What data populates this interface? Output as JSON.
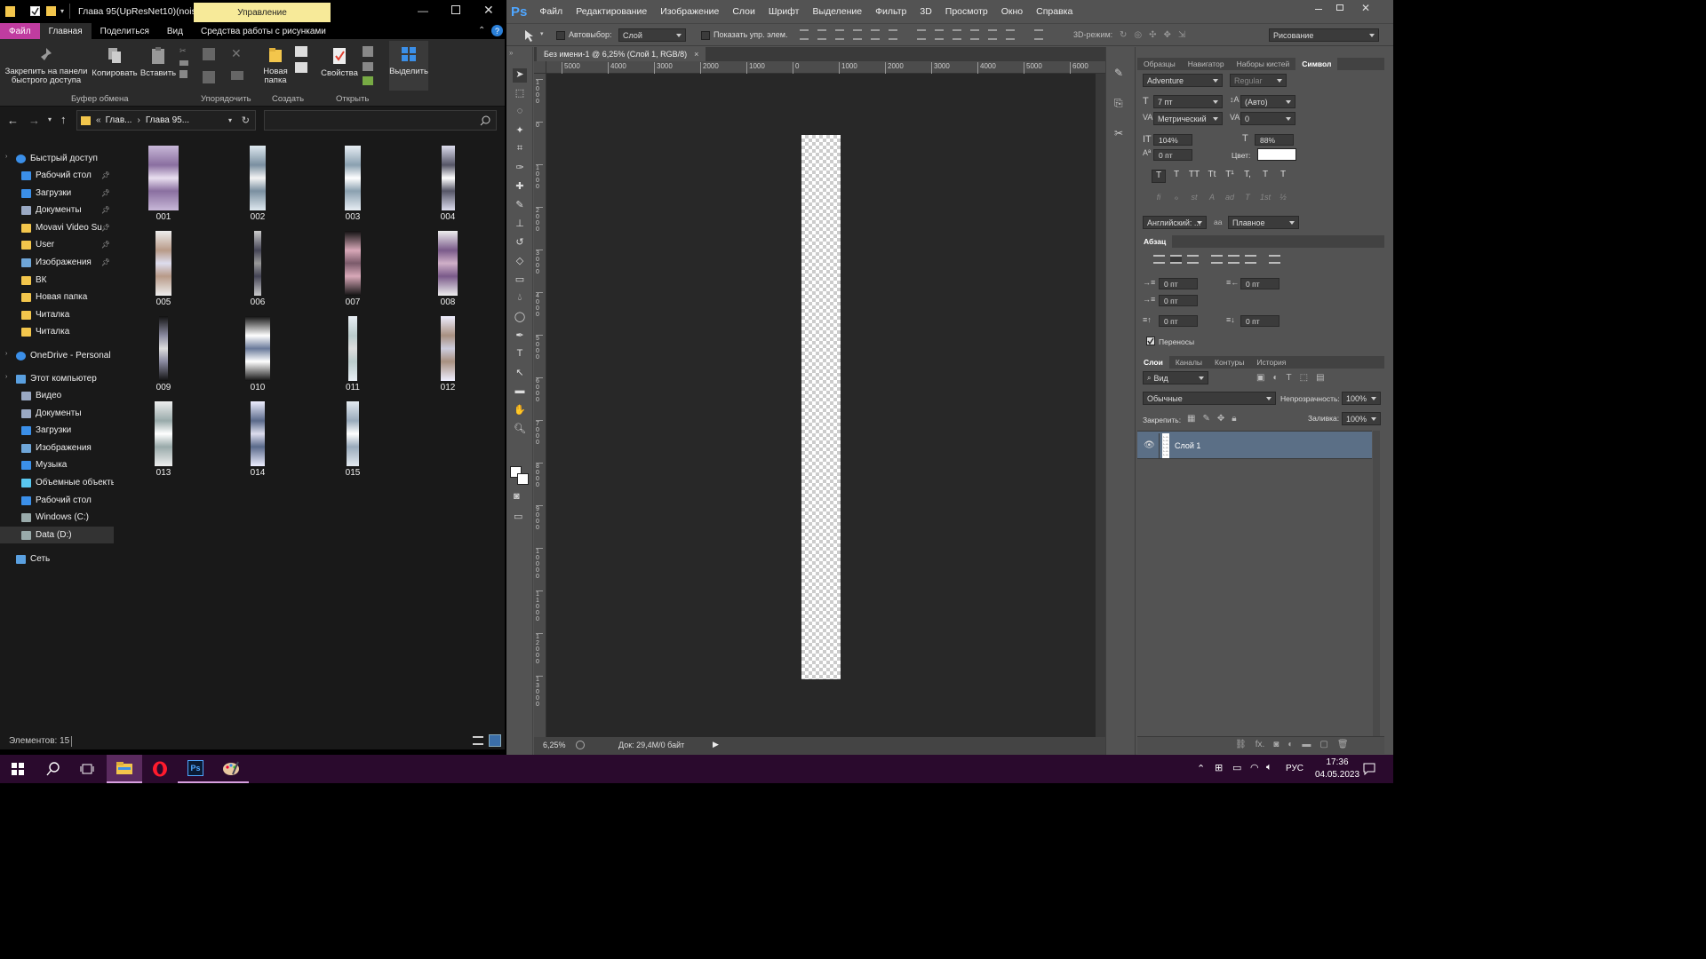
{
  "explorer": {
    "title": "Глава 95(UpResNet10)(nois...",
    "manage_tab": "Управление",
    "tabs": [
      "Файл",
      "Главная",
      "Поделиться",
      "Вид",
      "Средства работы с рисунками"
    ],
    "ribbon": {
      "pin_label": "Закрепить на панели быстрого доступа",
      "copy": "Копировать",
      "paste": "Вставить",
      "new_folder": "Новая папка",
      "properties": "Свойства",
      "select": "Выделить",
      "groups": [
        "Буфер обмена",
        "Упорядочить",
        "Создать",
        "Открыть"
      ]
    },
    "path_prefix": "«",
    "path": [
      "Глав...",
      "Глава 95..."
    ],
    "sidebar": [
      {
        "label": "Быстрый доступ",
        "icon": "star-icon",
        "color": "#3b8fe8"
      },
      {
        "label": "Рабочий стол",
        "icon": "desktop-icon",
        "color": "#3b8fe8",
        "pinned": true
      },
      {
        "label": "Загрузки",
        "icon": "download-icon",
        "color": "#3b8fe8",
        "pinned": true
      },
      {
        "label": "Документы",
        "icon": "documents-icon",
        "color": "#9aa9c4",
        "pinned": true
      },
      {
        "label": "Movavi Video Su",
        "icon": "folder-icon",
        "color": "#f3c64c",
        "pinned": true
      },
      {
        "label": "User",
        "icon": "folder-icon",
        "color": "#f3c64c",
        "pinned": true
      },
      {
        "label": "Изображения",
        "icon": "pictures-icon",
        "color": "#6fa6d8",
        "pinned": true
      },
      {
        "label": "ВК",
        "icon": "folder-icon",
        "color": "#f3c64c"
      },
      {
        "label": "Новая папка",
        "icon": "folder-icon",
        "color": "#f3c64c"
      },
      {
        "label": "Читалка",
        "icon": "folder-icon",
        "color": "#f3c64c"
      },
      {
        "label": "Читалка",
        "icon": "folder-icon",
        "color": "#f3c64c"
      },
      {
        "label": "OneDrive - Personal",
        "icon": "cloud-icon",
        "color": "#3b8fe8"
      },
      {
        "label": "Этот компьютер",
        "icon": "computer-icon",
        "color": "#5aa0e0"
      },
      {
        "label": "Видео",
        "icon": "video-icon",
        "color": "#9aa9c4"
      },
      {
        "label": "Документы",
        "icon": "documents-icon",
        "color": "#9aa9c4"
      },
      {
        "label": "Загрузки",
        "icon": "download-icon",
        "color": "#3b8fe8"
      },
      {
        "label": "Изображения",
        "icon": "pictures-icon",
        "color": "#6fa6d8"
      },
      {
        "label": "Музыка",
        "icon": "music-icon",
        "color": "#3b8fe8"
      },
      {
        "label": "Объемные объекты",
        "icon": "3d-objects-icon",
        "color": "#5ac8f0"
      },
      {
        "label": "Рабочий стол",
        "icon": "desktop-icon",
        "color": "#3b8fe8"
      },
      {
        "label": "Windows (C:)",
        "icon": "drive-icon",
        "color": "#9aa"
      },
      {
        "label": "Data (D:)",
        "icon": "drive-icon",
        "color": "#9aa"
      },
      {
        "label": "Сеть",
        "icon": "network-icon",
        "color": "#5aa0e0"
      }
    ],
    "files": [
      "001",
      "002",
      "003",
      "004",
      "005",
      "006",
      "007",
      "008",
      "009",
      "010",
      "011",
      "012",
      "013",
      "014",
      "015"
    ],
    "status": "Элементов: 15"
  },
  "photoshop": {
    "logo": "Ps",
    "menu": [
      "Файл",
      "Редактирование",
      "Изображение",
      "Слои",
      "Шрифт",
      "Выделение",
      "Фильтр",
      "3D",
      "Просмотр",
      "Окно",
      "Справка"
    ],
    "options": {
      "autoselect_label": "Автовыбор:",
      "autoselect_value": "Слой",
      "show_controls": "Показать упр. элем.",
      "mode_3d": "3D-режим:",
      "workspace": "Рисование"
    },
    "doc_tab": "Без имени-1 @ 6,25% (Слой 1, RGB/8)",
    "ruler_h": [
      "5000",
      "4000",
      "3000",
      "2000",
      "1000",
      "0",
      "1000",
      "2000",
      "3000",
      "4000",
      "5000",
      "6000"
    ],
    "ruler_v": [
      "1 0 0 0",
      "0",
      "1 0 0 0",
      "2 0 0 0",
      "3 0 0 0",
      "4 0 0 0",
      "5 0 0 0",
      "6 0 0 0",
      "7 0 0 0",
      "8 0 0 0",
      "9 0 0 0",
      "1 0 0 0 0",
      "1 1 0 0 0",
      "1 2 0 0 0",
      "1 3 0 0 0"
    ],
    "zoom": "6,25%",
    "doc_info": "Док: 29,4M/0 байт",
    "panel_tabs_top": [
      "Образцы",
      "Навигатор",
      "Наборы кистей",
      "Символ"
    ],
    "character": {
      "font": "Adventure",
      "style": "Regular",
      "size": "7 пт",
      "leading": "(Авто)",
      "kerning": "Метрический",
      "tracking": "0",
      "vscale": "104%",
      "hscale": "88%",
      "baseline": "0 пт",
      "color_label": "Цвет:",
      "language": "Английский: ...",
      "aa_label": "aa",
      "antialias": "Плавное",
      "style_buttons": [
        "T",
        "T",
        "TT",
        "Tt",
        "T¹",
        "T,",
        "T",
        "T"
      ],
      "opentype_buttons": [
        "fi",
        "ℴ",
        "st",
        "A",
        "ad",
        "T",
        "1st",
        "½"
      ]
    },
    "paragraph": {
      "tab": "Абзац",
      "fields": [
        "0 пт",
        "0 пт",
        "0 пт",
        "0 пт",
        "0 пт"
      ],
      "hyphenate": "Переносы"
    },
    "layers": {
      "tabs": [
        "Слои",
        "Каналы",
        "Контуры",
        "История"
      ],
      "filter": "Вид",
      "blend": "Обычные",
      "opacity_label": "Непрозрачность:",
      "opacity": "100%",
      "lock_label": "Закрепить:",
      "fill_label": "Заливка:",
      "fill": "100%",
      "layer_name": "Слой 1",
      "footer_fx": "fx."
    }
  },
  "taskbar": {
    "lang": "РУС",
    "time": "17:36",
    "date": "04.05.2023"
  },
  "colors": {
    "explorer_bg": "#191919",
    "ps_panel": "#535353",
    "ps_doc_bg": "#282828",
    "accent_file_tab": "#c03ca0",
    "manage_tab_bg": "#f7ea99",
    "taskbar_bg": "#2a0a2d",
    "layer_selected": "#5b6f86"
  }
}
